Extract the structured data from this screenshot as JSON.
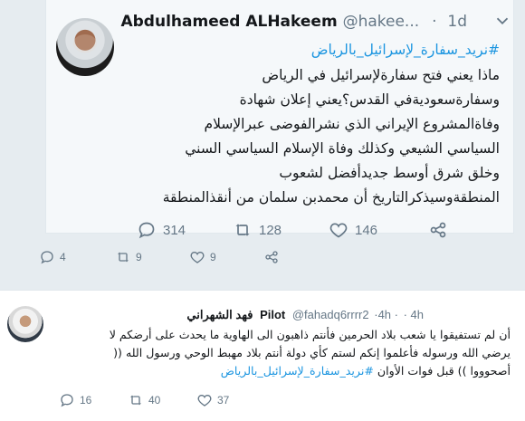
{
  "top_partial": {
    "reply_count": "4",
    "retweet_count": "9",
    "like_count": "9"
  },
  "tweet": {
    "display_name": "Abdulhameed ALHakeem",
    "handle": "@hakee...",
    "separator": "·",
    "time": "1d",
    "hashtag": "#نريد_سفارة_لإسرائيل_بالرياض",
    "lines": [
      "ماذا يعني فتح سفارةلإسرائيل في الرياض",
      "وسفارةسعوديةفي القدس؟يعني إعلان شهادة",
      "وفاةالمشروع الإيراني الذي نشرالفوضى عبرالإسلام",
      "السياسي الشيعي وكذلك وفاة الإسلام السياسي السني",
      "وخلق شرق أوسط جديدأفضل لشعوب",
      "المنطقةوسيذكرالتاريخ أن محمدبن سلمان من أنقذالمنطقة"
    ],
    "reply_count": "314",
    "retweet_count": "128",
    "like_count": "146"
  },
  "reply": {
    "display_name": "فهد الشهراني",
    "badge": "Pilot",
    "handle": "@fahadq6rrrr2",
    "meta_a": "·4h ·",
    "meta_b": "· 4h",
    "lines": [
      "أن لم تستفيقوا يا شعب بلاد الحرمين فأنتم ذاهبون الى الهاوية ما يحدث على أرضكم لا",
      "يرضي الله ورسوله فأعلموا إنكم لستم كأي دولة أنتم بلاد مهبط الوحي ورسول الله ((",
      "أصحوووا )) قبل فوات الأوان"
    ],
    "hashtag": "#نريد_سفارة_لإسرائيل_بالرياض",
    "reply_count": "16",
    "retweet_count": "40",
    "like_count": "37"
  },
  "colors": {
    "accent": "#1b95e0",
    "text": "#14171a",
    "muted": "#657786",
    "background": "#e6ecf0",
    "card": "#f5f8fa"
  },
  "icons": [
    "reply-icon",
    "retweet-icon",
    "like-icon",
    "share-icon",
    "chevron-down-icon"
  ]
}
